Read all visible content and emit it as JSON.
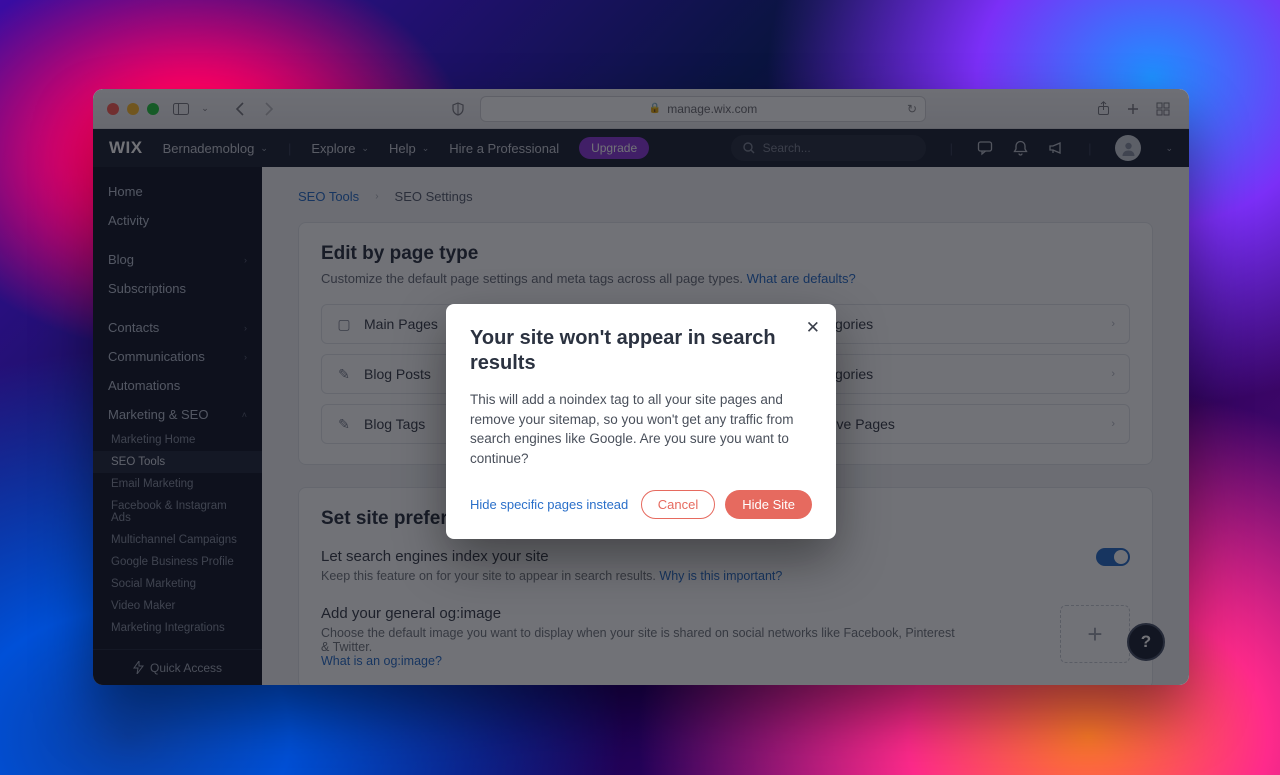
{
  "browser": {
    "url_host": "manage.wix.com"
  },
  "header": {
    "logo": "WIX",
    "site_name": "Bernademoblog",
    "nav": {
      "explore": "Explore",
      "help": "Help",
      "hire": "Hire a Professional"
    },
    "upgrade": "Upgrade",
    "search_placeholder": "Search..."
  },
  "sidebar": {
    "top": [
      {
        "label": "Home"
      },
      {
        "label": "Activity"
      }
    ],
    "groups": [
      {
        "label": "Blog",
        "chevron": true
      },
      {
        "label": "Subscriptions"
      }
    ],
    "groups2": [
      {
        "label": "Contacts",
        "chevron": true
      },
      {
        "label": "Communications",
        "chevron": true
      },
      {
        "label": "Automations"
      },
      {
        "label": "Marketing & SEO",
        "chevron": true,
        "expanded": true
      }
    ],
    "subs": [
      {
        "label": "Marketing Home"
      },
      {
        "label": "SEO Tools",
        "active": true
      },
      {
        "label": "Email Marketing"
      },
      {
        "label": "Facebook & Instagram Ads"
      },
      {
        "label": "Multichannel Campaigns"
      },
      {
        "label": "Google Business Profile"
      },
      {
        "label": "Social Marketing"
      },
      {
        "label": "Video Maker"
      },
      {
        "label": "Marketing Integrations"
      }
    ],
    "quick": "Quick Access"
  },
  "breadcrumbs": {
    "a": "SEO Tools",
    "b": "SEO Settings"
  },
  "edit_card": {
    "title": "Edit by page type",
    "subtitle": "Customize the default page settings and meta tags across all page types.",
    "link": "What are defaults?",
    "items_left": [
      "Main Pages",
      "Blog Posts",
      "Blog Tags"
    ],
    "items_right": [
      "Blog Categories",
      "Blog Categories",
      "Blog Archive Pages"
    ]
  },
  "prefs_card": {
    "title": "Set site preferences",
    "index": {
      "title": "Let search engines index your site",
      "desc": "Keep this feature on for your site to appear in search results.",
      "link": "Why is this important?"
    },
    "og": {
      "title": "Add your general og:image",
      "desc": "Choose the default image you want to display when your site is shared on social networks like Facebook, Pinterest & Twitter.",
      "link": "What is an og:image?"
    }
  },
  "modal": {
    "title": "Your site won't appear in search results",
    "body": "This will add a noindex tag to all your site pages and remove your sitemap, so you won't get any traffic from search engines like Google. Are you sure you want to continue?",
    "hide_link": "Hide specific pages instead",
    "cancel": "Cancel",
    "confirm": "Hide Site"
  }
}
